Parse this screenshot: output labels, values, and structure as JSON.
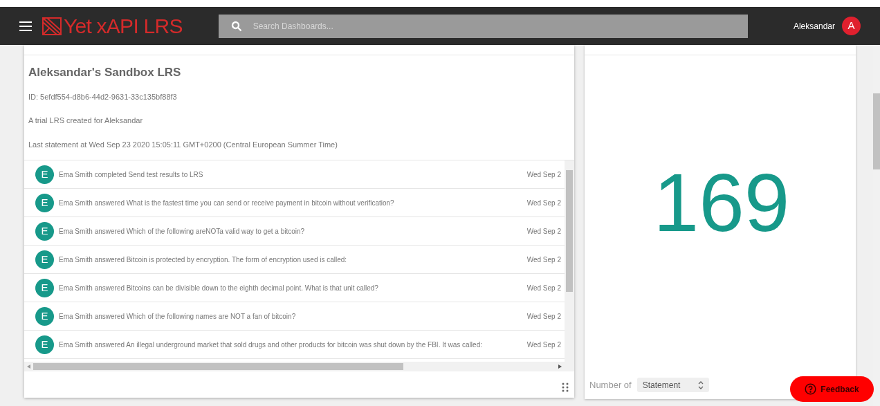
{
  "header": {
    "logo": "Yet xAPI LRS",
    "search": {
      "placeholder": "Search Dashboards..."
    },
    "user": {
      "name": "Aleksandar",
      "initial": "A"
    }
  },
  "lrs_card": {
    "title": "Aleksandar's Sandbox LRS",
    "id": "ID: 5efdf554-d8b6-44d2-9631-33c135bf88f3",
    "description": "A trial LRS created for Aleksandar",
    "last_statement": "Last statement at Wed Sep 23 2020 15:05:11 GMT+0200 (Central European Summer Time)",
    "statements": [
      {
        "initial": "E",
        "text": "Ema Smith completed Send test results to LRS",
        "date": "Wed Sep 2"
      },
      {
        "initial": "E",
        "text": "Ema Smith answered What is the fastest time you can send or receive payment in bitcoin without verification?",
        "date": "Wed Sep 2"
      },
      {
        "initial": "E",
        "text": "Ema Smith answered Which of the following areNOTa valid way to get a bitcoin?",
        "date": "Wed Sep 2"
      },
      {
        "initial": "E",
        "text": "Ema Smith answered Bitcoin is protected by encryption. The form of encryption used is called:",
        "date": "Wed Sep 2"
      },
      {
        "initial": "E",
        "text": "Ema Smith answered Bitcoins can be divisible down to the eighth decimal point. What is that unit called?",
        "date": "Wed Sep 2"
      },
      {
        "initial": "E",
        "text": "Ema Smith answered Which of the following names are NOT a fan of bitcoin?",
        "date": "Wed Sep 2"
      },
      {
        "initial": "E",
        "text": "Ema Smith answered An illegal underground market that sold drugs and other products for bitcoin was shut down by the FBI. It was called:",
        "date": "Wed Sep 2"
      }
    ]
  },
  "counter_card": {
    "value": "169",
    "label": "Number of",
    "select": "Statement"
  },
  "feedback_button": "Feedback"
}
